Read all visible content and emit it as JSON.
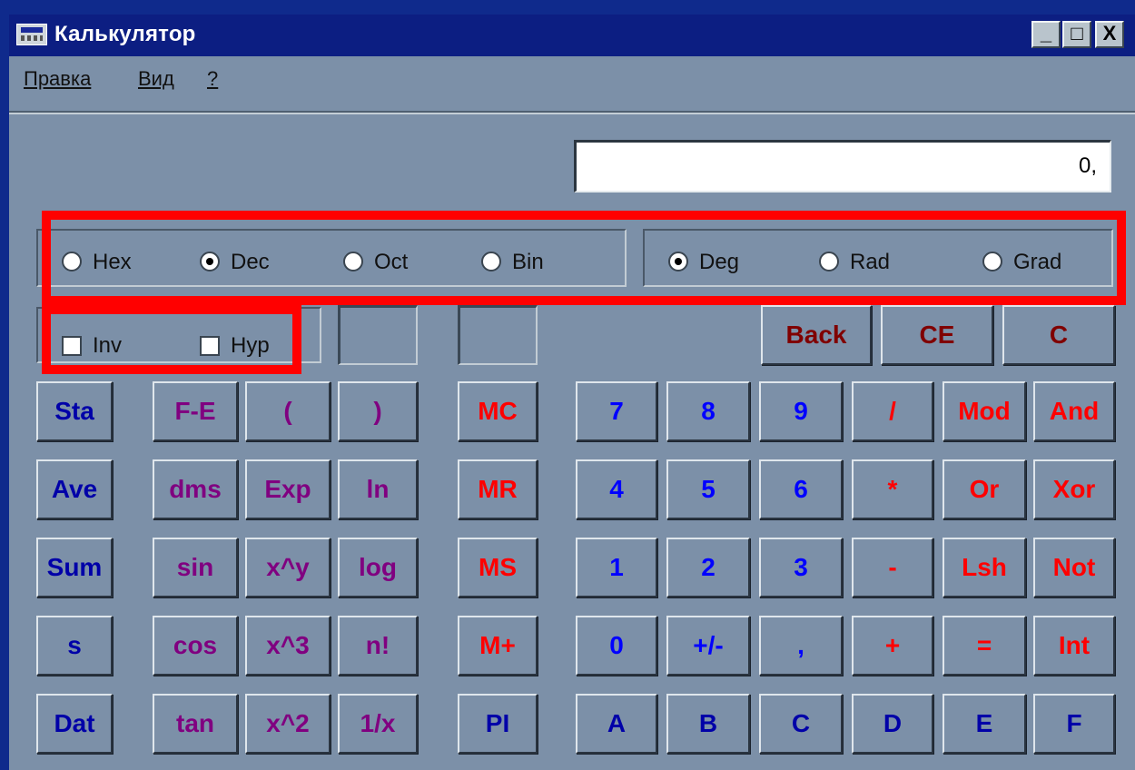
{
  "window": {
    "title": "Калькулятор",
    "controls": [
      "_",
      "□",
      "X"
    ]
  },
  "menu": [
    {
      "label": "Правка"
    },
    {
      "label": "Вид"
    },
    {
      "label": "?"
    }
  ],
  "display": {
    "value": "0,"
  },
  "number_system": [
    {
      "label": "Hex",
      "selected": false
    },
    {
      "label": "Dec",
      "selected": true
    },
    {
      "label": "Oct",
      "selected": false
    },
    {
      "label": "Bin",
      "selected": false
    }
  ],
  "angle_units": [
    {
      "label": "Deg",
      "selected": true
    },
    {
      "label": "Rad",
      "selected": false
    },
    {
      "label": "Grad",
      "selected": false
    }
  ],
  "modifiers": [
    {
      "label": "Inv",
      "checked": false
    },
    {
      "label": "Hyp",
      "checked": false
    }
  ],
  "edit_keys": [
    "Back",
    "CE",
    "C"
  ],
  "stat_keys": [
    "Sta",
    "Ave",
    "Sum",
    "s",
    "Dat"
  ],
  "func_keys": [
    [
      "F-E",
      "(",
      ")"
    ],
    [
      "dms",
      "Exp",
      "ln"
    ],
    [
      "sin",
      "x^y",
      "log"
    ],
    [
      "cos",
      "x^3",
      "n!"
    ],
    [
      "tan",
      "x^2",
      "1/x"
    ]
  ],
  "memory_keys": [
    "MC",
    "MR",
    "MS",
    "M+",
    "PI"
  ],
  "main_keys": [
    [
      "7",
      "8",
      "9",
      "/",
      "Mod",
      "And"
    ],
    [
      "4",
      "5",
      "6",
      "*",
      "Or",
      "Xor"
    ],
    [
      "1",
      "2",
      "3",
      "-",
      "Lsh",
      "Not"
    ],
    [
      "0",
      "+/-",
      ",",
      "+",
      "=",
      "Int"
    ],
    [
      "A",
      "B",
      "C",
      "D",
      "E",
      "F"
    ]
  ],
  "colors": {
    "title_bar": "#0c1e82",
    "window_bg": "#7c90a8",
    "stat_text": "#0000a8",
    "func_text": "#800080",
    "memory_text": "#ff0000",
    "digit_text": "#0000ff",
    "operator_text": "#ff0000",
    "edit_text": "#800000",
    "hex_digit_text": "#0000a8",
    "highlight": "#ff0000"
  }
}
